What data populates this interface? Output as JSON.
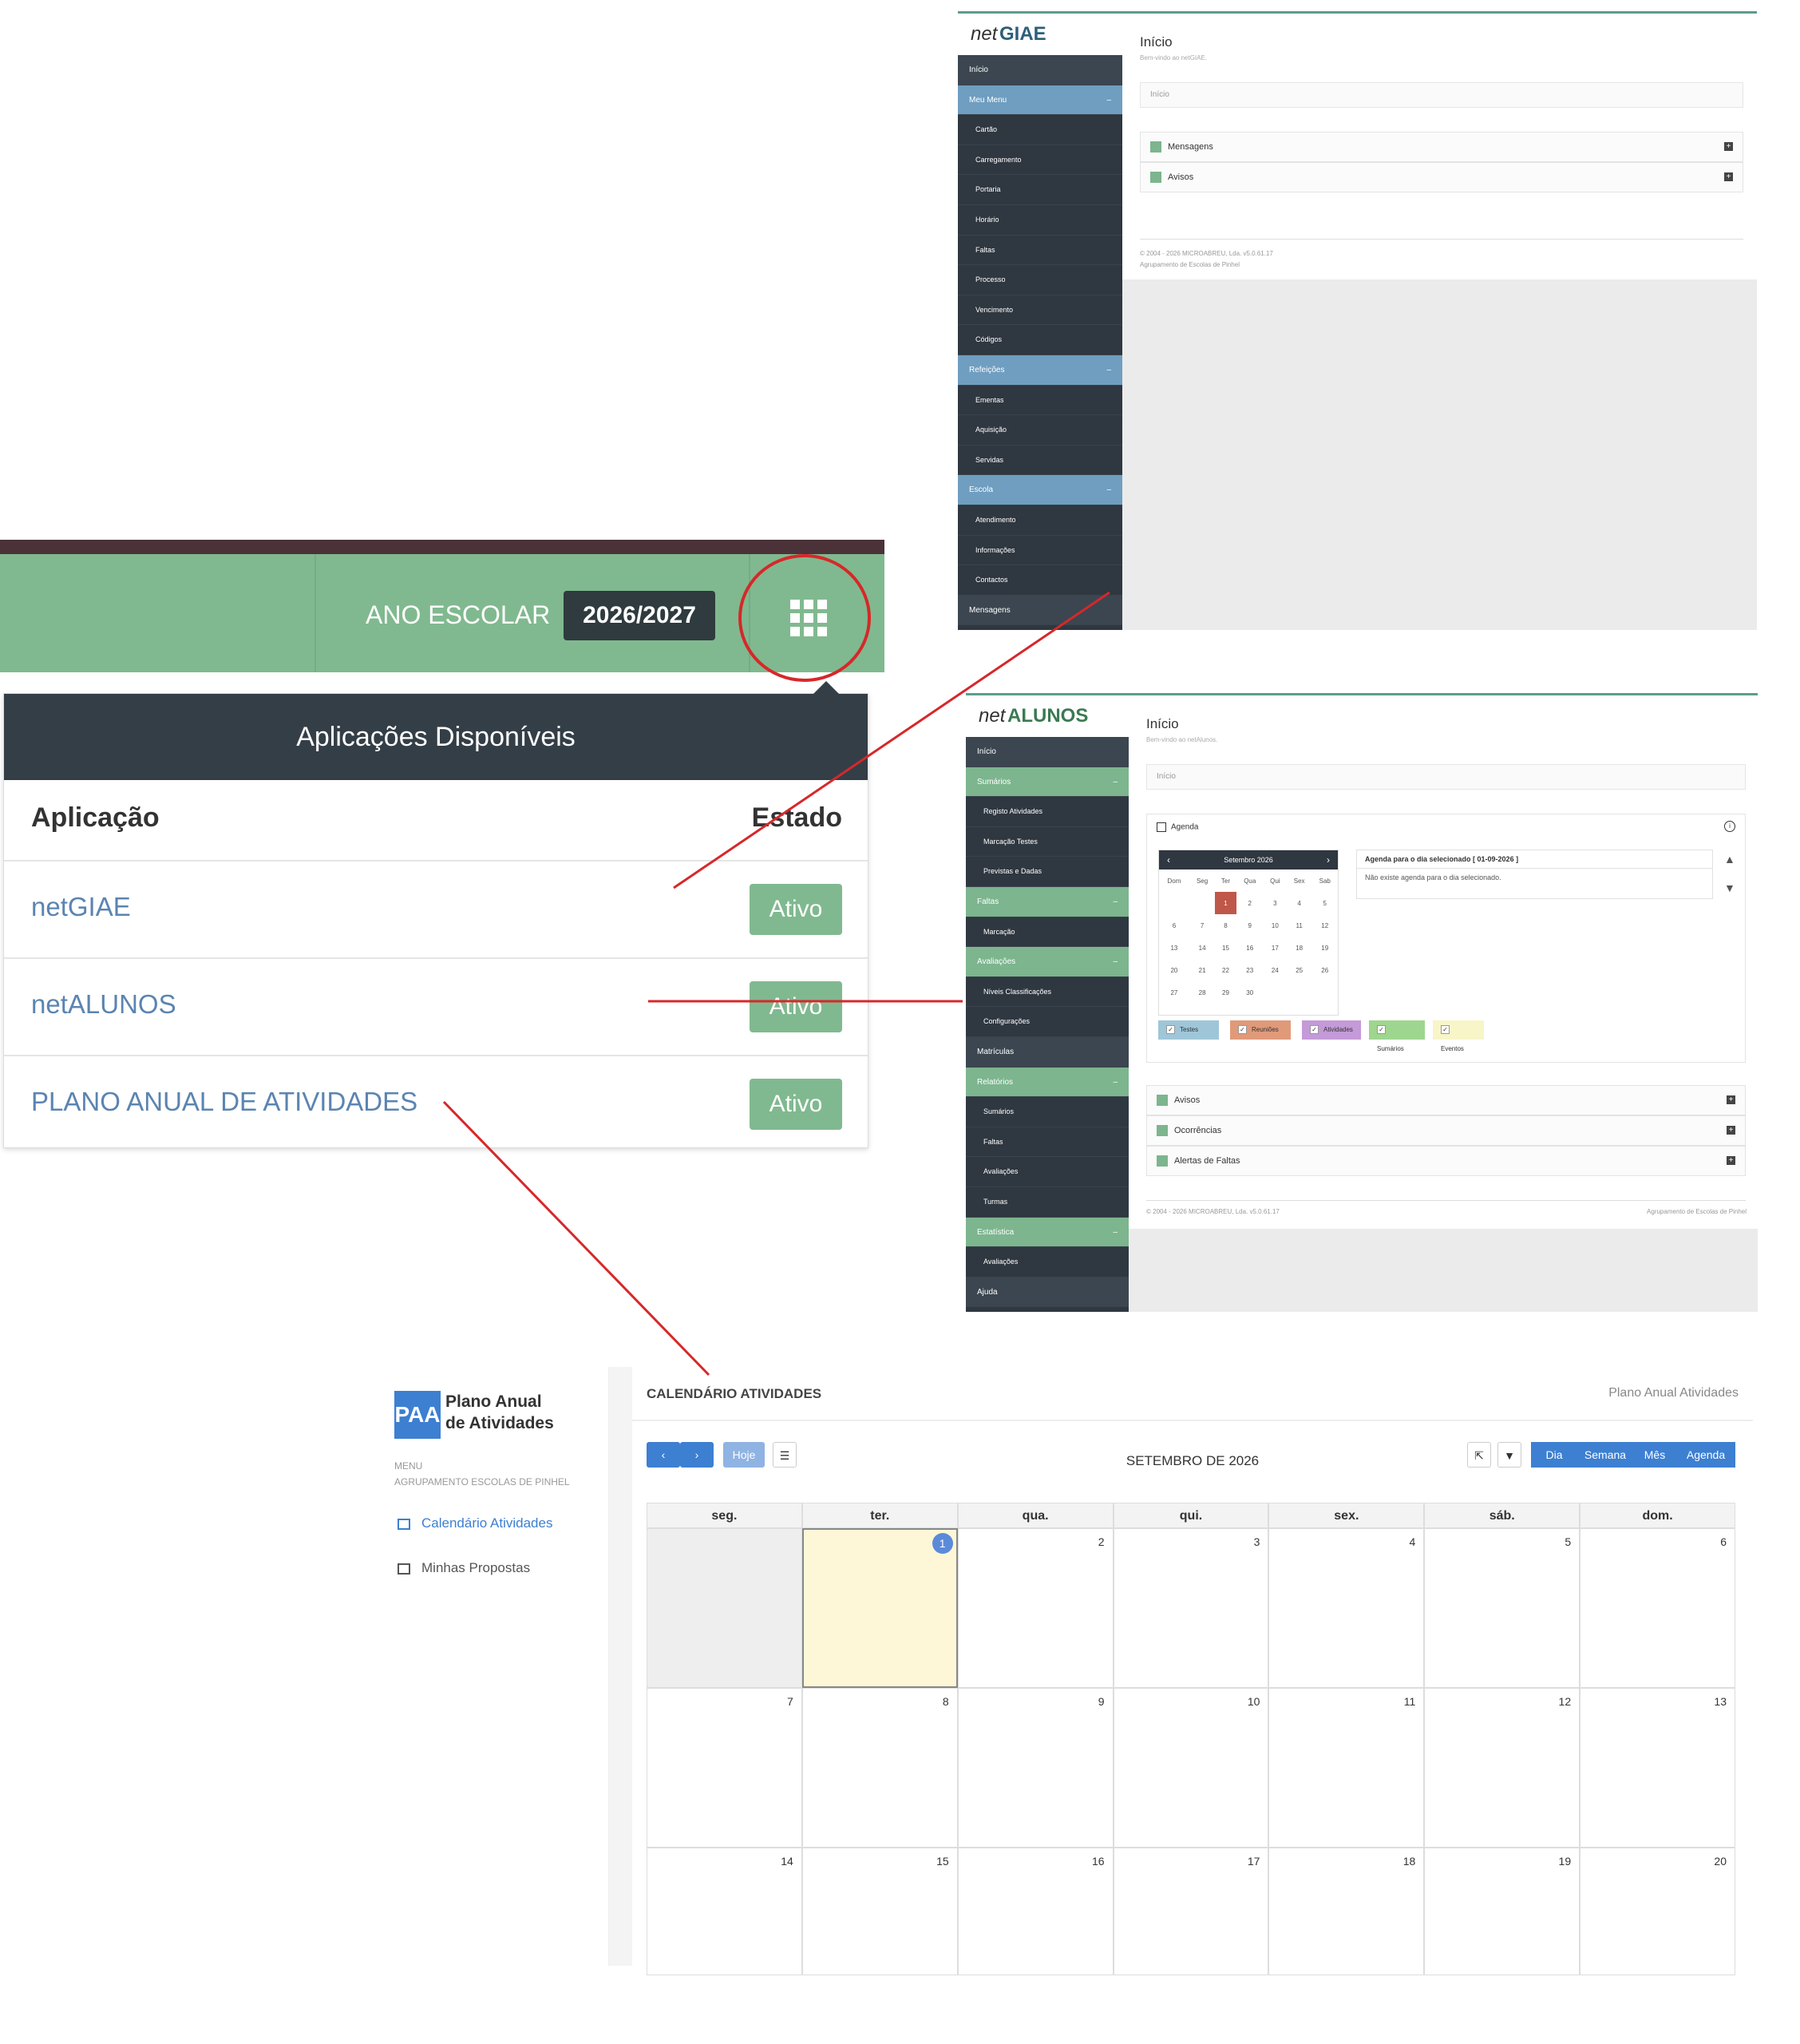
{
  "topbar": {
    "ano_label": "ANO ESCOLAR",
    "year": "2026/2027",
    "apps_icon": "grid-icon"
  },
  "popup": {
    "title": "Aplicações Disponíveis",
    "col_app": "Aplicação",
    "col_state": "Estado",
    "rows": [
      {
        "name": "netGIAE",
        "state": "Ativo"
      },
      {
        "name": "netALUNOS",
        "state": "Ativo"
      },
      {
        "name": "PLANO ANUAL DE ATIVIDADES",
        "state": "Ativo"
      }
    ]
  },
  "giae": {
    "logo_net": "net",
    "logo_brand": "GIAE",
    "title": "Início",
    "welcome": "Bem-vindo ao netGIAE.",
    "breadcrumb": "Início",
    "menu": [
      {
        "label": "Início",
        "kind": "top"
      },
      {
        "label": "Meu Menu",
        "kind": "group"
      },
      {
        "label": "Cartão",
        "kind": "sub"
      },
      {
        "label": "Carregamento",
        "kind": "sub"
      },
      {
        "label": "Portaria",
        "kind": "sub"
      },
      {
        "label": "Horário",
        "kind": "sub"
      },
      {
        "label": "Faltas",
        "kind": "sub"
      },
      {
        "label": "Processo",
        "kind": "sub"
      },
      {
        "label": "Vencimento",
        "kind": "sub"
      },
      {
        "label": "Códigos",
        "kind": "sub"
      },
      {
        "label": "Refeições",
        "kind": "group"
      },
      {
        "label": "Ementas",
        "kind": "sub"
      },
      {
        "label": "Aquisição",
        "kind": "sub"
      },
      {
        "label": "Servidas",
        "kind": "sub"
      },
      {
        "label": "Escola",
        "kind": "group"
      },
      {
        "label": "Atendimento",
        "kind": "sub"
      },
      {
        "label": "Informações",
        "kind": "sub"
      },
      {
        "label": "Contactos",
        "kind": "sub"
      },
      {
        "label": "Mensagens",
        "kind": "top"
      }
    ],
    "panels": [
      "Mensagens",
      "Avisos"
    ],
    "footer": "© 2004 - 2026 MICROABREU, Lda.     v5.0.61.17",
    "footer2": "Agrupamento de Escolas de Pinhel"
  },
  "alunos": {
    "logo_net": "net",
    "logo_brand": "ALUNOS",
    "title": "Início",
    "welcome": "Bem-vindo ao netAlunos.",
    "breadcrumb": "Início",
    "menu": [
      {
        "label": "Início",
        "kind": "top"
      },
      {
        "label": "Sumários",
        "kind": "group"
      },
      {
        "label": "Registo Atividades",
        "kind": "sub"
      },
      {
        "label": "Marcação Testes",
        "kind": "sub"
      },
      {
        "label": "Previstas e Dadas",
        "kind": "sub"
      },
      {
        "label": "Faltas",
        "kind": "group"
      },
      {
        "label": "Marcação",
        "kind": "sub"
      },
      {
        "label": "Avaliações",
        "kind": "group"
      },
      {
        "label": "Níveis Classificações",
        "kind": "sub"
      },
      {
        "label": "Configurações",
        "kind": "sub"
      },
      {
        "label": "Matrículas",
        "kind": "top"
      },
      {
        "label": "Relatórios",
        "kind": "group"
      },
      {
        "label": "Sumários",
        "kind": "sub"
      },
      {
        "label": "Faltas",
        "kind": "sub"
      },
      {
        "label": "Avaliações",
        "kind": "sub"
      },
      {
        "label": "Turmas",
        "kind": "sub"
      },
      {
        "label": "Estatística",
        "kind": "group"
      },
      {
        "label": "Avaliações",
        "kind": "sub"
      },
      {
        "label": "Ajuda",
        "kind": "top"
      }
    ],
    "agenda_title": "Agenda",
    "mini_month": "Setembro 2026",
    "weekdays": [
      "Dom",
      "Seg",
      "Ter",
      "Qua",
      "Qui",
      "Sex",
      "Sab"
    ],
    "mini_weeks": [
      [
        "",
        "",
        "1",
        "2",
        "3",
        "4",
        "5"
      ],
      [
        "6",
        "7",
        "8",
        "9",
        "10",
        "11",
        "12"
      ],
      [
        "13",
        "14",
        "15",
        "16",
        "17",
        "18",
        "19"
      ],
      [
        "20",
        "21",
        "22",
        "23",
        "24",
        "25",
        "26"
      ],
      [
        "27",
        "28",
        "29",
        "30",
        "",
        "",
        ""
      ]
    ],
    "agenda_day_title": "Agenda para o dia selecionado [ 01-09-2026 ]",
    "agenda_day_empty": "Não existe agenda para o dia selecionado.",
    "legend": [
      {
        "label": "Testes",
        "color": "#9fc6d8"
      },
      {
        "label": "Reuniões",
        "color": "#e09a7a"
      },
      {
        "label": "Atividades",
        "color": "#c49ad8"
      },
      {
        "label": "Sumários",
        "color": "#9ed68f"
      },
      {
        "label": "Eventos",
        "color": "#f8f5c8"
      }
    ],
    "panels": [
      "Avisos",
      "Ocorrências",
      "Alertas de Faltas"
    ],
    "footer": "© 2004 - 2026 MICROABREU, Lda.     v5.0.61.17",
    "footer_right": "Agrupamento de Escolas de Pinhel"
  },
  "paa": {
    "logo_abbr": "PAA",
    "logo_line1": "Plano Anual",
    "logo_line2": "de Atividades",
    "menu_label": "MENU",
    "school": "AGRUPAMENTO ESCOLAS DE PINHEL",
    "nav": [
      {
        "label": "Calendário Atividades",
        "active": true
      },
      {
        "label": "Minhas Propostas",
        "active": false
      }
    ],
    "header_title": "CALENDÁRIO ATIVIDADES",
    "header_right": "Plano Anual Atividades",
    "today_btn": "Hoje",
    "month_title": "SETEMBRO DE 2026",
    "views": [
      "Dia",
      "Semana",
      "Mês",
      "Agenda"
    ],
    "weekdays": [
      "seg.",
      "ter.",
      "qua.",
      "qui.",
      "sex.",
      "sáb.",
      "dom."
    ],
    "weeks": [
      [
        "",
        "1",
        "2",
        "3",
        "4",
        "5",
        "6"
      ],
      [
        "7",
        "8",
        "9",
        "10",
        "11",
        "12",
        "13"
      ],
      [
        "14",
        "15",
        "16",
        "17",
        "18",
        "19",
        "20"
      ]
    ]
  },
  "colors": {
    "accent_green": "#80b98f",
    "sidebar_dark": "#2f3740",
    "link_blue": "#5b84b1",
    "highlight_red": "#d6282a",
    "paa_blue": "#3d7fd1"
  }
}
